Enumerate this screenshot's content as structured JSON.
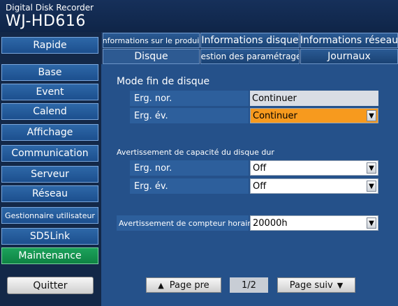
{
  "brand": {
    "subtitle": "Digital Disk Recorder",
    "model": "WJ-HD616"
  },
  "sidebar": {
    "items": [
      {
        "label": "Rapide"
      },
      {
        "label": "Base"
      },
      {
        "label": "Event"
      },
      {
        "label": "Calend"
      },
      {
        "label": "Affichage"
      },
      {
        "label": "Communication"
      },
      {
        "label": "Serveur"
      },
      {
        "label": "Réseau"
      },
      {
        "label": "Gestionnaire utilisateur"
      },
      {
        "label": "SD5Link"
      },
      {
        "label": "Maintenance",
        "active": true
      }
    ],
    "quit_label": "Quitter"
  },
  "tabs": {
    "row1": [
      "Informations sur le produit",
      "Informations disque",
      "Informations réseau"
    ],
    "row2": [
      "Disque",
      "Gestion des paramétrages",
      "Journaux"
    ],
    "active": "Disque"
  },
  "disk_end": {
    "title": "Mode fin de disque",
    "normal": {
      "label": "Erg. nor.",
      "value": "Continuer"
    },
    "event": {
      "label": "Erg. év.",
      "value": "Continuer"
    }
  },
  "capacity_warning": {
    "title": "Avertissement de capacité du disque dur",
    "normal": {
      "label": "Erg. nor.",
      "value": "Off"
    },
    "event": {
      "label": "Erg. év.",
      "value": "Off"
    }
  },
  "hour_meter": {
    "label": "Avertissement de compteur horaire",
    "value": "20000h"
  },
  "pagination": {
    "prev_label": "Page pre",
    "indicator": "1/2",
    "next_label": "Page suiv",
    "prev_arrow": "▲",
    "next_arrow": "▼"
  },
  "icons": {
    "dropdown": "▼"
  },
  "colors": {
    "active_menu": "#0e8343",
    "highlight_select": "#f79a1e",
    "content_bg": "#25518a"
  }
}
